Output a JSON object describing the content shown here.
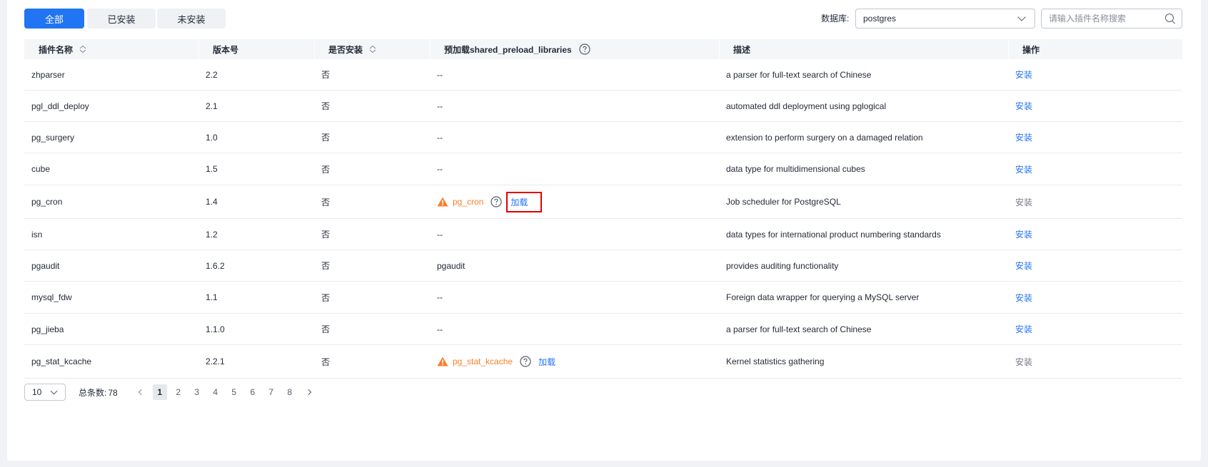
{
  "tabs": [
    {
      "label": "全部",
      "active": true
    },
    {
      "label": "已安装",
      "active": false
    },
    {
      "label": "未安装",
      "active": false
    }
  ],
  "database": {
    "label": "数据库:",
    "value": "postgres"
  },
  "search": {
    "placeholder": "请输入插件名称搜索",
    "value": ""
  },
  "table": {
    "headers": [
      "插件名称",
      "版本号",
      "是否安装",
      "预加载shared_preload_libraries",
      "描述",
      "操作"
    ],
    "rows": [
      {
        "name": "zhparser",
        "version": "2.2",
        "installed": "否",
        "preload": "--",
        "preload_type": "none",
        "description": "a parser for full-text search of Chinese",
        "action": "安装",
        "action_enabled": true
      },
      {
        "name": "pgl_ddl_deploy",
        "version": "2.1",
        "installed": "否",
        "preload": "--",
        "preload_type": "none",
        "description": "automated ddl deployment using pglogical",
        "action": "安装",
        "action_enabled": true
      },
      {
        "name": "pg_surgery",
        "version": "1.0",
        "installed": "否",
        "preload": "--",
        "preload_type": "none",
        "description": "extension to perform surgery on a damaged relation",
        "action": "安装",
        "action_enabled": true
      },
      {
        "name": "cube",
        "version": "1.5",
        "installed": "否",
        "preload": "--",
        "preload_type": "none",
        "description": "data type for multidimensional cubes",
        "action": "安装",
        "action_enabled": true
      },
      {
        "name": "pg_cron",
        "version": "1.4",
        "installed": "否",
        "preload": "pg_cron",
        "preload_type": "warning",
        "load_label": "加载",
        "description": "Job scheduler for PostgreSQL",
        "action": "安装",
        "action_enabled": false
      },
      {
        "name": "isn",
        "version": "1.2",
        "installed": "否",
        "preload": "--",
        "preload_type": "none",
        "description": "data types for international product numbering standards",
        "action": "安装",
        "action_enabled": true
      },
      {
        "name": "pgaudit",
        "version": "1.6.2",
        "installed": "否",
        "preload": "pgaudit",
        "preload_type": "plain",
        "description": "provides auditing functionality",
        "action": "安装",
        "action_enabled": true
      },
      {
        "name": "mysql_fdw",
        "version": "1.1",
        "installed": "否",
        "preload": "--",
        "preload_type": "none",
        "description": "Foreign data wrapper for querying a MySQL server",
        "action": "安装",
        "action_enabled": true
      },
      {
        "name": "pg_jieba",
        "version": "1.1.0",
        "installed": "否",
        "preload": "--",
        "preload_type": "none",
        "description": "a parser for full-text search of Chinese",
        "action": "安装",
        "action_enabled": true
      },
      {
        "name": "pg_stat_kcache",
        "version": "2.2.1",
        "installed": "否",
        "preload": "pg_stat_kcache",
        "preload_type": "warning",
        "load_label": "加载",
        "description": "Kernel statistics gathering",
        "action": "安装",
        "action_enabled": false
      }
    ]
  },
  "pagination": {
    "page_size": "10",
    "total_label": "总条数:",
    "total": "78",
    "pages": [
      "1",
      "2",
      "3",
      "4",
      "5",
      "6",
      "7",
      "8"
    ],
    "current": "1"
  },
  "colors": {
    "accent": "#2174f2",
    "warning": "#f97f2d",
    "highlight_border": "#e00000"
  }
}
